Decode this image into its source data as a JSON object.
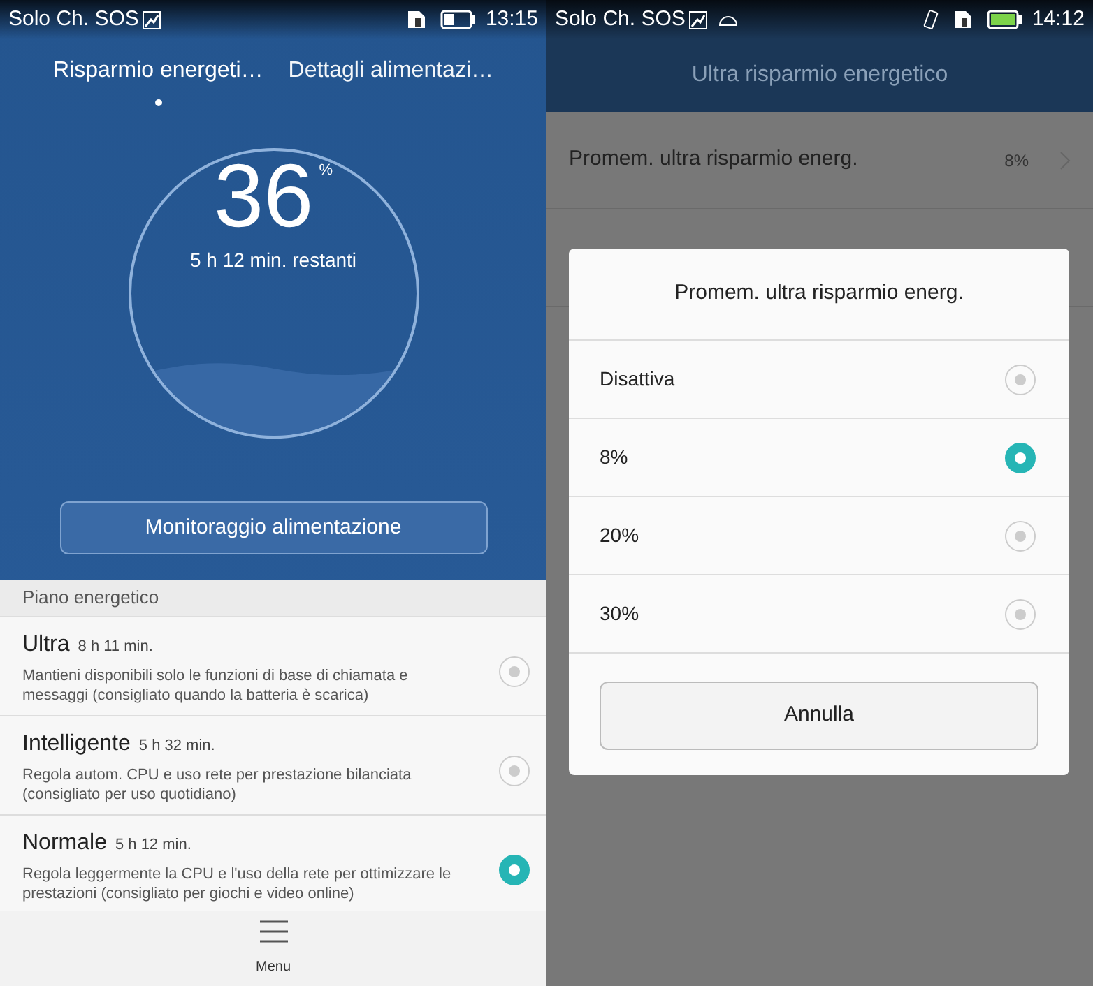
{
  "left": {
    "status_bar": {
      "carrier": "Solo Ch. SOS",
      "time": "13:15"
    },
    "tabs": [
      {
        "label": "Risparmio energeti…",
        "selected": true
      },
      {
        "label": "Dettagli alimentazi…",
        "selected": false
      }
    ],
    "battery": {
      "percent": "36",
      "unit": "%",
      "remaining": "5 h 12 min. restanti"
    },
    "monitor_button": "Monitoraggio alimentazione",
    "plan_header": "Piano energetico",
    "plans": [
      {
        "name": "Ultra",
        "duration": "8 h 11 min.",
        "description": "Mantieni disponibili solo le funzioni di base di chiamata e messaggi (consigliato quando la batteria è scarica)",
        "selected": false
      },
      {
        "name": "Intelligente",
        "duration": "5 h 32 min.",
        "description": "Regola autom. CPU e uso rete per prestazione bilanciata (consigliato per uso quotidiano)",
        "selected": false
      },
      {
        "name": "Normale",
        "duration": "5 h 12 min.",
        "description": "Regola leggermente la CPU e l'uso della rete per ottimizzare le prestazioni (consigliato per giochi e video online)",
        "selected": true
      }
    ],
    "menu_label": "Menu"
  },
  "right": {
    "status_bar": {
      "carrier": "Solo Ch. SOS",
      "time": "14:12"
    },
    "title": "Ultra risparmio energetico",
    "setting_row": {
      "label": "Promem. ultra risparmio energ.",
      "value": "8%"
    },
    "dialog": {
      "title": "Promem. ultra risparmio energ.",
      "options": [
        {
          "label": "Disattiva",
          "selected": false
        },
        {
          "label": "8%",
          "selected": true
        },
        {
          "label": "20%",
          "selected": false
        },
        {
          "label": "30%",
          "selected": false
        }
      ],
      "cancel": "Annulla"
    }
  }
}
